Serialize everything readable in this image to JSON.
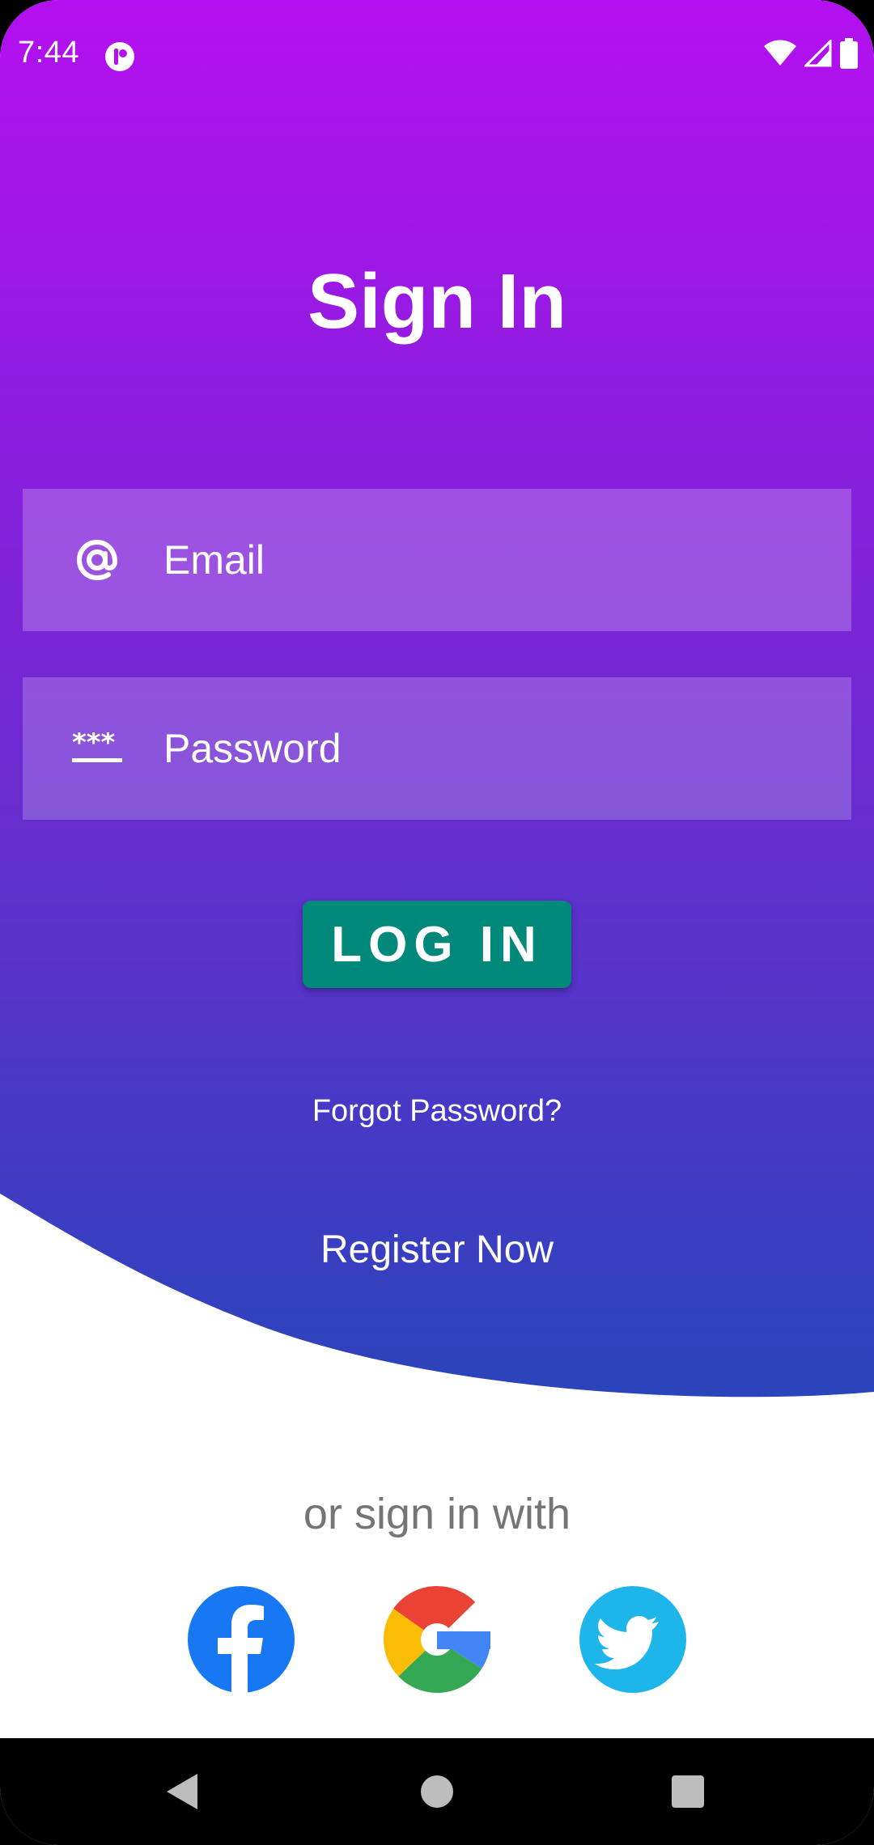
{
  "status_bar": {
    "time": "7:44",
    "icons": [
      "app-notification-icon",
      "wifi-icon",
      "cellular-signal-icon",
      "battery-icon"
    ]
  },
  "title": "Sign In",
  "email_field": {
    "placeholder": "Email",
    "value": "",
    "icon": "at-sign-icon"
  },
  "password_field": {
    "placeholder": "Password",
    "value": "",
    "icon": "password-dots-icon"
  },
  "login_button": {
    "label": "LOG IN",
    "color": "#00897b"
  },
  "forgot_password": "Forgot Password?",
  "register": "Register Now",
  "alt_signin": {
    "label": "or sign in with",
    "providers": [
      "facebook-icon",
      "google-icon",
      "twitter-icon"
    ]
  },
  "nav": {
    "buttons": [
      "back-icon",
      "home-icon",
      "recents-icon"
    ]
  },
  "colors": {
    "gradient_top": "#b40ff0",
    "gradient_mid": "#7a25d6",
    "gradient_bottom": "#2a44bb",
    "facebook": "#1877f2",
    "twitter": "#1da1f2"
  }
}
